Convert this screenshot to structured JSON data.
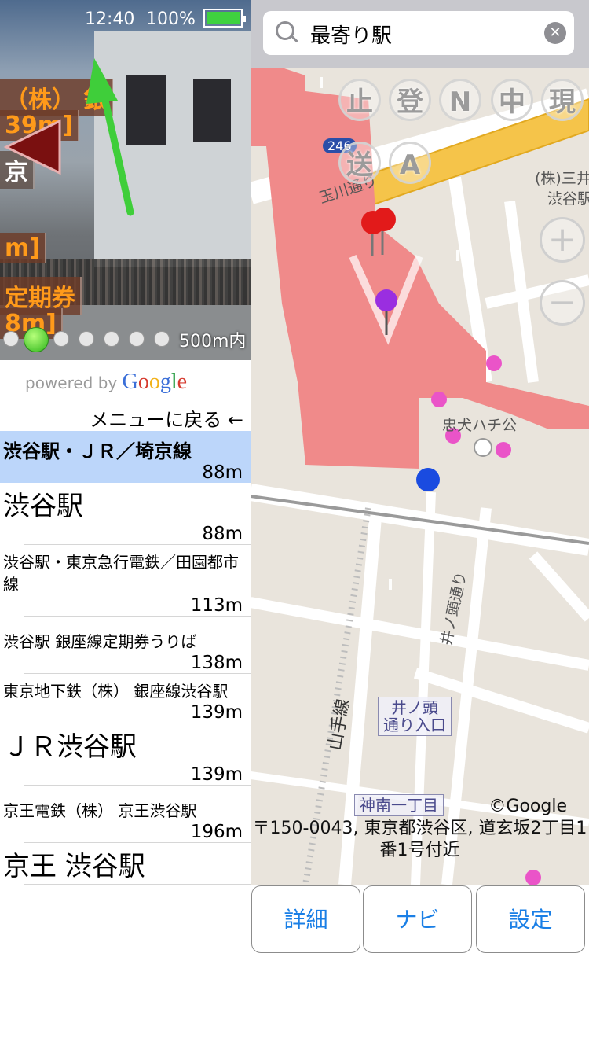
{
  "status_bar": {
    "time": "12:40",
    "battery": "100%",
    "battery_level": 1.0
  },
  "camera": {
    "ar_labels": [
      "（株） 銀",
      "39m]",
      "京",
      "m]",
      "定期券",
      "8m]"
    ],
    "page_dots": 7,
    "active_dot": 1,
    "range_text": "500m内"
  },
  "powered_by": {
    "prefix": "powered by",
    "brand": "Google"
  },
  "menu_back": "メニューに戻る ←",
  "list": [
    {
      "name": "渋谷駅・ＪＲ／埼京線",
      "dist": "88m",
      "style": "selected"
    },
    {
      "name": "渋谷駅",
      "dist": "88m",
      "style": "big"
    },
    {
      "name": "渋谷駅・東京急行電鉄／田園都市線",
      "dist": "113m",
      "style": "small"
    },
    {
      "name": "渋谷駅 銀座線定期券うりば",
      "dist": "138m",
      "style": "small"
    },
    {
      "name": "東京地下鉄（株） 銀座線渋谷駅",
      "dist": "139m",
      "style": "small"
    },
    {
      "name": "ＪＲ渋谷駅",
      "dist": "139m",
      "style": "big"
    },
    {
      "name": "京王電鉄（株） 京王渋谷駅",
      "dist": "196m",
      "style": "small"
    },
    {
      "name": "京王 渋谷駅",
      "dist": "",
      "style": "big"
    }
  ],
  "search": {
    "value": "最寄り駅",
    "clear_icon": "clear-icon"
  },
  "map": {
    "mode_buttons": [
      "止",
      "登",
      "N",
      "中",
      "現",
      "送",
      "A"
    ],
    "zoom_in": "+",
    "zoom_out": "−",
    "labels": {
      "road_246": "246",
      "tamagawa": "玉川通り",
      "bank_1": "(株)三井",
      "bank_2": "渋谷駅",
      "hachiko": "忠犬ハチ公",
      "inokashira": "井ノ頭通り",
      "yamanote": "山手線",
      "poi_inokashira_1": "井ノ頭",
      "poi_inokashira_2": "通り入口",
      "poi_jinnan": "神南一丁目"
    },
    "copyright": "©Google",
    "address": "〒150-0043, 東京都渋谷区, 道玄坂2丁目1番1号付近"
  },
  "buttons": {
    "detail": "詳細",
    "navi": "ナビ",
    "settings": "設定"
  },
  "colors": {
    "station_area": "#f08a8a",
    "accent": "#1a7fe6",
    "selected_row": "#bcd6fa",
    "ar_text": "#ff9a1a"
  }
}
